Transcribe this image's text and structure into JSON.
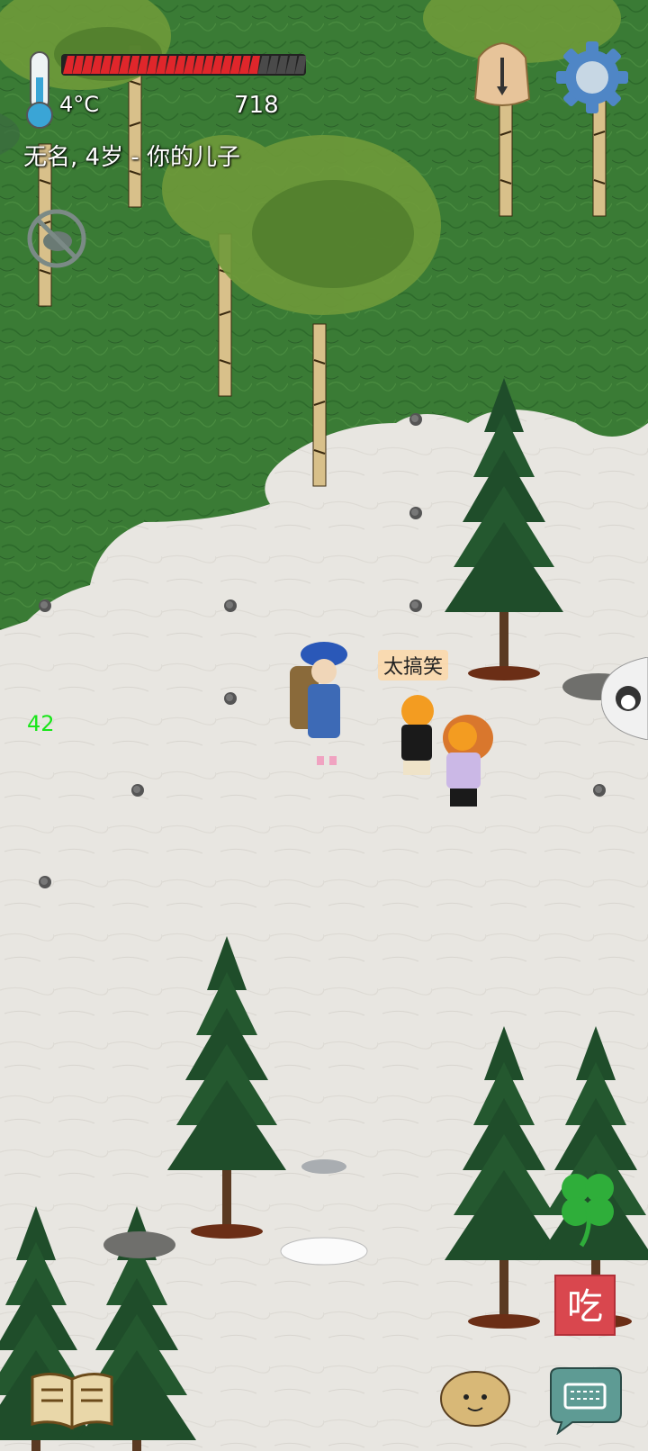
{
  "hud": {
    "temperature": "4°C",
    "yum_count": "718",
    "character_name": "无名, 4岁 - 你的儿子",
    "food_level": 0.81,
    "fps": "42"
  },
  "world": {
    "speech_bubble": "太搞笑"
  },
  "buttons": {
    "eat_label": "吃"
  },
  "colors": {
    "forest": "#3b7d35",
    "snow": "#e9e7e2",
    "food_full": "#e0262b",
    "food_empty": "#4a4a4a",
    "eat_button": "#d9474e",
    "fps_text": "#19e619"
  },
  "icons": [
    "thermometer-icon",
    "clock-icon",
    "gear-icon",
    "no-pet-icon",
    "clover-icon",
    "book-icon",
    "emote-face-icon",
    "keyboard-icon"
  ]
}
